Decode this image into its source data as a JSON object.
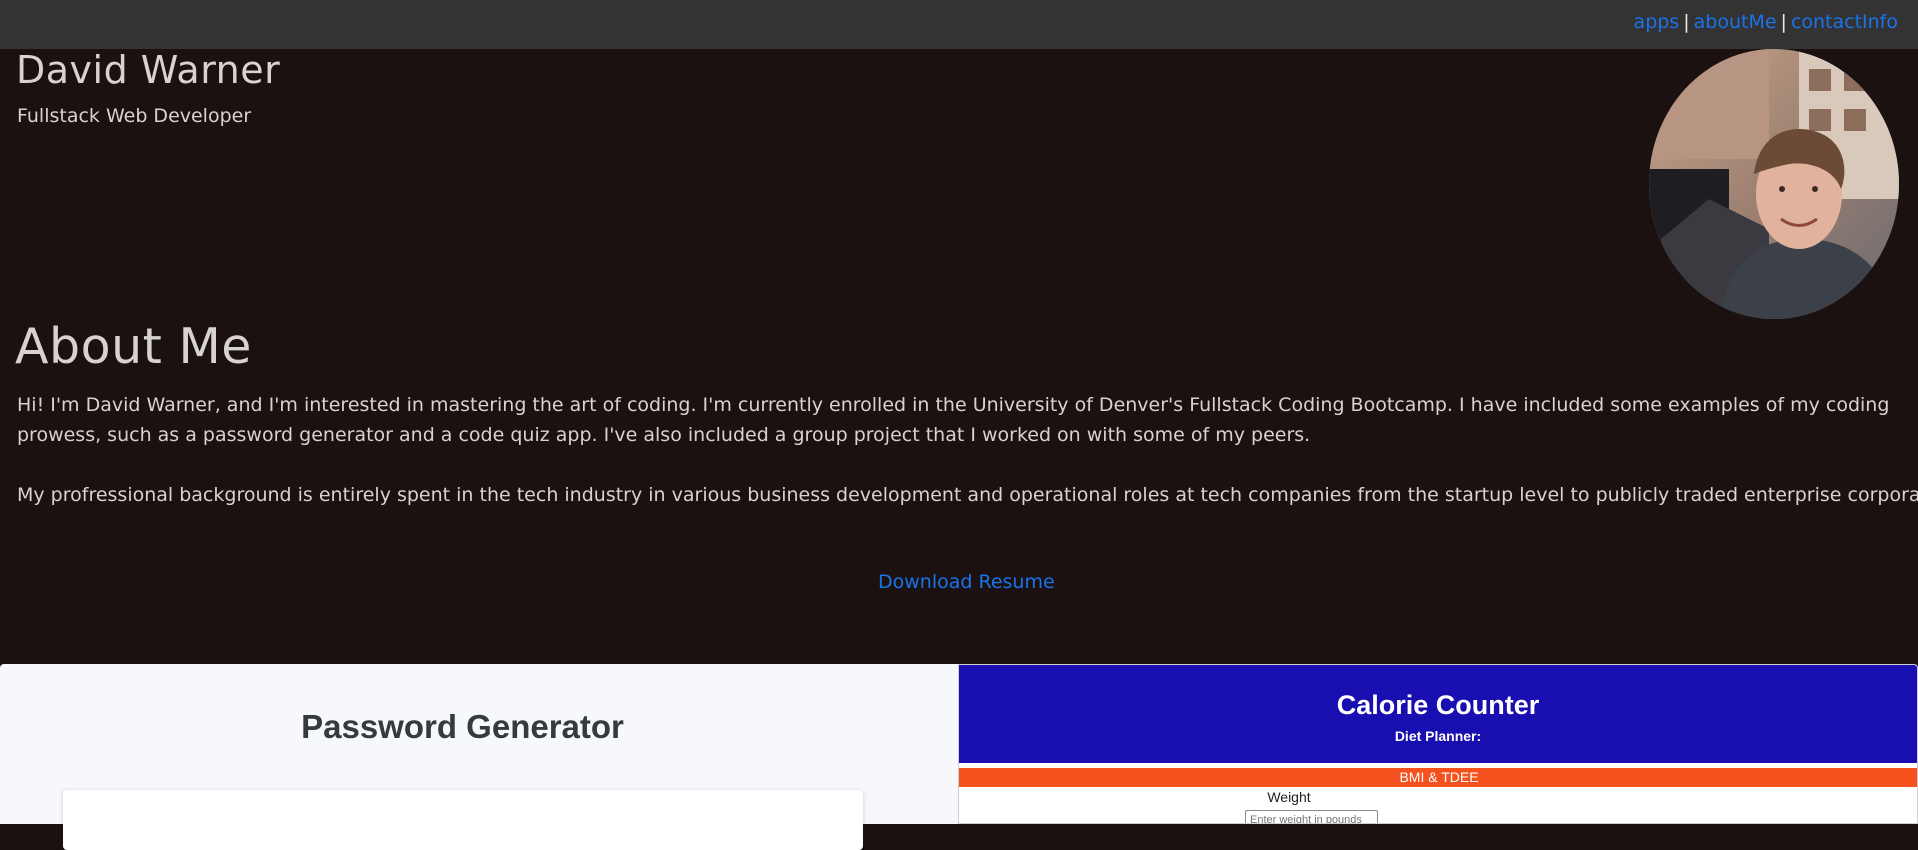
{
  "nav": {
    "links": [
      "apps",
      "aboutMe",
      "contactInfo"
    ],
    "separator": "|"
  },
  "hero": {
    "name": "David Warner",
    "role": "Fullstack Web Developer",
    "avatar_icon": "profile-photo"
  },
  "about": {
    "title": "About Me",
    "paragraph1": "Hi! I'm David Warner, and I'm interested in mastering the art of coding. I'm currently enrolled in the University of Denver's Fullstack Coding Bootcamp. I have included some examples of my coding prowess, such as a password generator and a code quiz app. I've also included a group project that I worked on with some of my peers.",
    "paragraph2": "My profressional background is entirely spent in the tech industry in various business development and operational roles at tech companies from the startup level to publicly traded enterprise corporations.",
    "resume_link": "Download Resume"
  },
  "apps": {
    "password_generator": {
      "title": "Password Generator"
    },
    "calorie_counter": {
      "title": "Calorie Counter",
      "subtitle": "Diet Planner:",
      "section": "BMI & TDEE",
      "weight_label": "Weight",
      "weight_placeholder": "Enter weight in pounds"
    }
  },
  "colors": {
    "background": "#1a1110",
    "nav_background": "#333333",
    "link": "#1a73e8",
    "text": "#d6d3d1",
    "calorie_header": "#190fb0",
    "bmi_bar": "#f5511f"
  }
}
